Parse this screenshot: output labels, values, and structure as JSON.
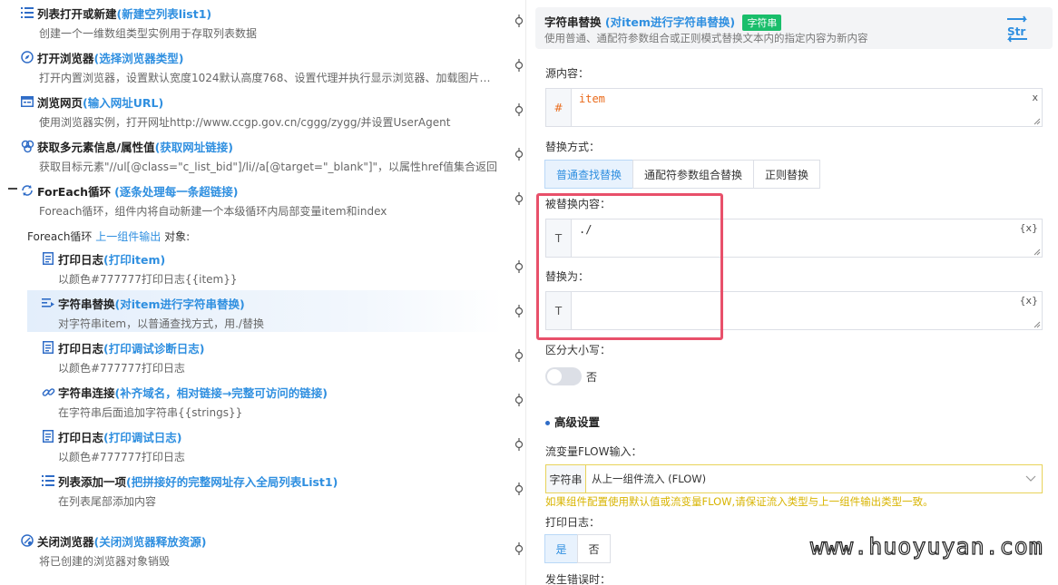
{
  "steps": [
    {
      "title": "列表打开或新建",
      "alias": "(新建空列表list1)",
      "desc": "创建一个一维数组类型实例用于存取列表数据",
      "icon": "list-icon"
    },
    {
      "title": "打开浏览器",
      "alias": "(选择浏览器类型)",
      "desc": "打开内置浏览器，设置默认宽度1024默认高度768、设置代理并执行显示浏览器、加载图片、…",
      "icon": "compass-icon"
    },
    {
      "title": "浏览网页",
      "alias": "(输入网址URL)",
      "desc": "使用浏览器实例，打开网址http://www.ccgp.gov.cn/cggg/zygg/并设置UserAgent",
      "icon": "browser-window-icon"
    },
    {
      "title": "获取多元素信息/属性值",
      "alias": "(获取网址链接)",
      "desc": "获取目标元素\"//ul[@class=\"c_list_bid\"]/li//a[@target=\"_blank\"]\"，以属性href值集合返回",
      "icon": "elements-icon"
    },
    {
      "title": "ForEach循环",
      "alias": "(逐条处理每一条超链接)",
      "desc": "Foreach循环，组件内将自动新建一个本级循环内局部变量item和index",
      "icon": "loop-icon"
    },
    {
      "title": "打印日志",
      "alias": "(打印item)",
      "desc": "以颜色#777777打印日志{{item}}",
      "icon": "log-icon"
    },
    {
      "title": "字符串替换",
      "alias": "(对item进行字符串替换)",
      "desc": "对字符串item，以普通查找方式，用./替换",
      "icon": "replace-icon"
    },
    {
      "title": "打印日志",
      "alias": "(打印调试诊断日志)",
      "desc": "以颜色#777777打印日志",
      "icon": "log-icon"
    },
    {
      "title": "字符串连接",
      "alias": "(补齐域名，相对链接→完整可访问的链接)",
      "desc": "在字符串后面追加字符串{{strings}}",
      "icon": "link-icon"
    },
    {
      "title": "打印日志",
      "alias": "(打印调试日志)",
      "desc": "以颜色#777777打印日志",
      "icon": "log-icon"
    },
    {
      "title": "列表添加一项",
      "alias": "(把拼接好的完整网址存入全局列表List1)",
      "desc": "在列表尾部添加内容",
      "icon": "list-add-icon"
    },
    {
      "title": "关闭浏览器",
      "alias": "(关闭浏览器释放资源)",
      "desc": "将已创建的浏览器对象销毁",
      "icon": "close-browser-icon"
    }
  ],
  "foreach_label": {
    "prefix": "Foreach循环 ",
    "link": "上一组件输出",
    "suffix": " 对象:"
  },
  "panel": {
    "title": "字符串替换",
    "alias": "(对item进行字符串替换)",
    "tag": "字符串",
    "subtitle": "使用普通、通配符参数组合或正则模式替换文本内的指定内容为新内容",
    "source_label": "源内容：",
    "source_prefix": "#",
    "source_value": "item",
    "source_clear": "x",
    "mode_label": "替换方式：",
    "modes": [
      "普通查找替换",
      "通配符参数组合替换",
      "正则替换"
    ],
    "active_mode": "普通查找替换",
    "find_label": "被替换内容：",
    "find_prefix": "T",
    "find_value": "./",
    "var_btn": "{x}",
    "replace_label": "替换为：",
    "replace_prefix": "T",
    "replace_value": "",
    "case_label": "区分大小写：",
    "case_value": "否",
    "case_enabled": false,
    "advanced_label": "高级设置",
    "flow_label": "流变量FLOW输入：",
    "flow_type": "字符串",
    "flow_value": "从上一组件流入 (FLOW)",
    "flow_warning": "如果组件配置使用默认值或流变量FLOW,请保证流入类型与上一组件输出类型一致。",
    "log_label": "打印日志：",
    "log_options": [
      "是",
      "否"
    ],
    "log_active": "是",
    "error_label": "发生错误时："
  },
  "watermark": "www.huoyuyan.com",
  "colors": {
    "accent": "#2f8fe0",
    "tag": "#19be6b",
    "highlight_box": "#e8506a",
    "warning": "#d8b400",
    "source_value": "#e96a1a"
  }
}
